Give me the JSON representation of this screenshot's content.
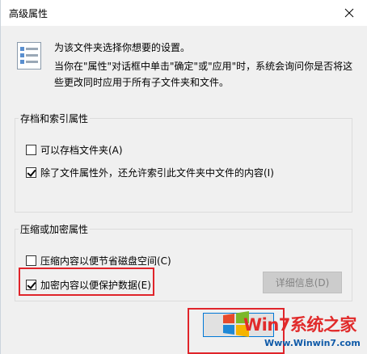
{
  "window": {
    "title": "高级属性"
  },
  "header": {
    "line1": "为该文件夹选择你想要的设置。",
    "line2": "当你在\"属性\"对话框中单击\"确定\"或\"应用\"时，系统会询问你是否将这些更改同时应用于所有子文件夹和文件。"
  },
  "archive_group": {
    "title": "存档和索引属性",
    "options": [
      {
        "label": "可以存档文件夹(A)",
        "checked": false
      },
      {
        "label": "除了文件属性外，还允许索引此文件夹中文件的内容(I)",
        "checked": true
      }
    ]
  },
  "compress_group": {
    "title": "压缩或加密属性",
    "options": [
      {
        "label": "压缩内容以便节省磁盘空间(C)",
        "checked": false
      },
      {
        "label": "加密内容以便保护数据(E)",
        "checked": true
      }
    ],
    "details_button": "详细信息(D)"
  },
  "watermark": {
    "main": "Win7系统之家",
    "sub": "Www.Winwin7.com"
  },
  "colors": {
    "highlight_border": "#e0242a",
    "disabled_text": "#838383",
    "watermark_red": "#e12a2a",
    "watermark_blue": "#0f5aa8"
  }
}
